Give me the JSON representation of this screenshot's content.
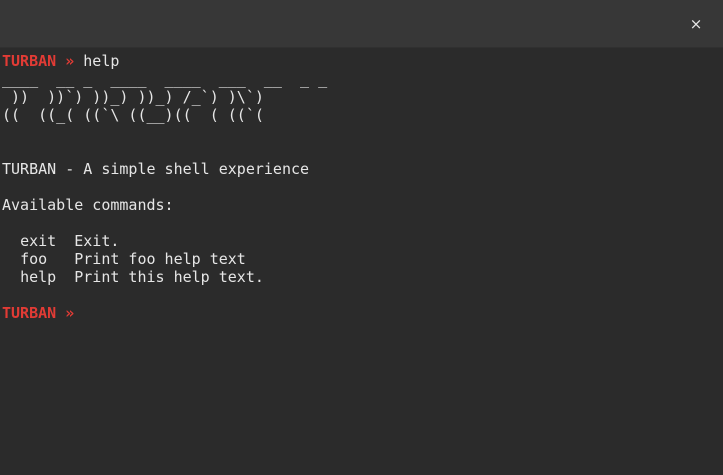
{
  "window": {
    "close_symbol": "×"
  },
  "colors": {
    "background": "#2b2b2b",
    "titlebar": "#373737",
    "prompt": "#e23b35",
    "text": "#e6e6e6"
  },
  "terminal": {
    "prompt_label": "TURBAN",
    "prompt_arrow": "»",
    "entered_command": "help",
    "banner": [
      "____  __ _  ____  ____  ___  __  _ _",
      " ))  ))`) ))_) ))_) /_`) )\\`)",
      "((  ((_( ((`\\ ((__)((  ( ((`("
    ],
    "description": "TURBAN - A simple shell experience",
    "commands_header": "Available commands:",
    "commands": [
      {
        "name": "exit",
        "desc": "Exit."
      },
      {
        "name": "foo",
        "desc": "Print foo help text"
      },
      {
        "name": "help",
        "desc": "Print this help text."
      }
    ]
  }
}
